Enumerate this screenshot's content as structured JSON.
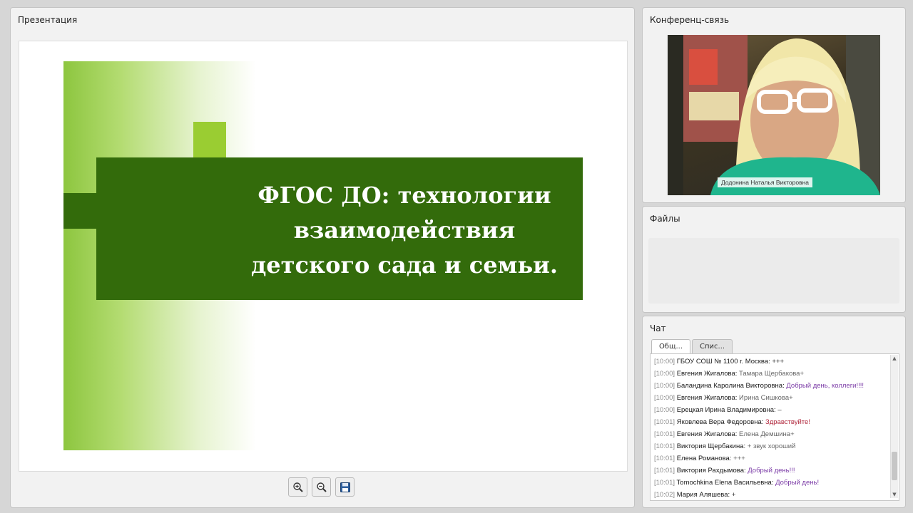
{
  "presentation": {
    "panel_title": "Презентация",
    "slide_title": "ФГОС ДО: технологии\nвзаимодействия\nдетского сада и семьи.",
    "colors": {
      "dark_green": "#336b0b",
      "mid_green": "#5a9a18",
      "light_green": "#9acd32",
      "gradient_green": "#8dc63f"
    },
    "toolbar": {
      "zoom_in_icon": "zoom-in-icon",
      "zoom_out_icon": "zoom-out-icon",
      "save_icon": "save-icon"
    }
  },
  "conference": {
    "panel_title": "Конференц-связь",
    "presenter_name": "Додонина Наталья Викторовна"
  },
  "files": {
    "panel_title": "Файлы"
  },
  "chat": {
    "panel_title": "Чат",
    "tabs": [
      {
        "label": "Общ...",
        "active": true
      },
      {
        "label": "Спис...",
        "active": false
      }
    ],
    "messages": [
      {
        "time": "[10:00]",
        "author": "ГБОУ СОШ № 1100 г. Москва:",
        "text": "+++",
        "color": "tx-dark"
      },
      {
        "time": "[10:00]",
        "author": "Евгения Жигалова:",
        "text": "Тамара Щербакова+",
        "color": "tx-grey"
      },
      {
        "time": "[10:00]",
        "author": "Баландина Каролина Викторовна:",
        "text": "Добрый день, коллеги!!!!",
        "color": "tx-purple"
      },
      {
        "time": "[10:00]",
        "author": "Евгения Жигалова:",
        "text": "Ирина Сишкова+",
        "color": "tx-grey"
      },
      {
        "time": "[10:00]",
        "author": "Ерецкая Ирина Владимировна:",
        "text": "–",
        "color": "tx-dark"
      },
      {
        "time": "[10:01]",
        "author": "Яковлева Вера Федоровна:",
        "text": "Здравствуйте!",
        "color": "tx-red"
      },
      {
        "time": "[10:01]",
        "author": "Евгения Жигалова:",
        "text": "Елена Демшина+",
        "color": "tx-grey"
      },
      {
        "time": "[10:01]",
        "author": "Виктория Щербакина:",
        "text": "+ звук хороший",
        "color": "tx-grey"
      },
      {
        "time": "[10:01]",
        "author": "Елена Романова:",
        "text": "+++",
        "color": "tx-grey"
      },
      {
        "time": "[10:01]",
        "author": "Виктория Рахдымова:",
        "text": "Добрый день!!!",
        "color": "tx-purple"
      },
      {
        "time": "[10:01]",
        "author": "Tomochkina Elena Васильевна:",
        "text": "Добрый день!",
        "color": "tx-purple"
      },
      {
        "time": "[10:02]",
        "author": "Мария Аляшева:",
        "text": "+",
        "color": "tx-dark"
      }
    ]
  }
}
